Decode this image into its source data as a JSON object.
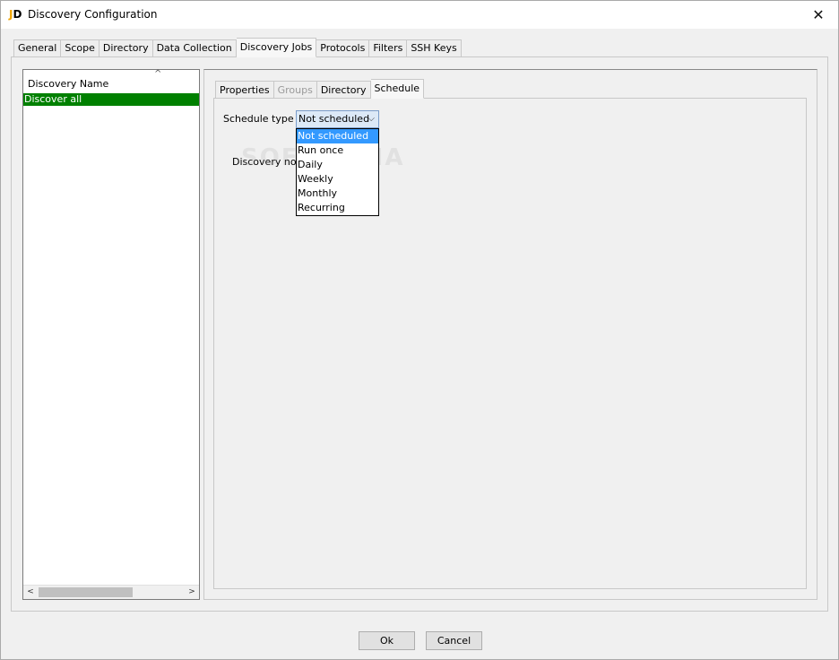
{
  "window": {
    "title": "Discovery Configuration",
    "icon": "jd-logo-icon",
    "close_glyph": "✕"
  },
  "main_tabs": [
    {
      "label": "General"
    },
    {
      "label": "Scope"
    },
    {
      "label": "Directory"
    },
    {
      "label": "Data Collection"
    },
    {
      "label": "Discovery Jobs",
      "active": true
    },
    {
      "label": "Protocols"
    },
    {
      "label": "Filters"
    },
    {
      "label": "SSH Keys"
    }
  ],
  "discovery_list": {
    "header": "Discovery Name",
    "sort_glyph": "^",
    "rows": [
      "Discover all"
    ],
    "selected_color": "#008000",
    "scroll_left": "<",
    "scroll_right": ">"
  },
  "sub_tabs": [
    {
      "label": "Properties"
    },
    {
      "label": "Groups",
      "disabled": true
    },
    {
      "label": "Directory"
    },
    {
      "label": "Schedule",
      "active": true
    }
  ],
  "schedule": {
    "type_label": "Schedule type",
    "selected": "Not scheduled",
    "chevron": "⌵",
    "options": [
      "Not scheduled",
      "Run once",
      "Daily",
      "Weekly",
      "Monthly",
      "Recurring"
    ],
    "status_text": "Discovery not s",
    "highlight_color": "#3399ff"
  },
  "watermark": "SOFTPEDIA",
  "buttons": {
    "ok": "Ok",
    "cancel": "Cancel"
  }
}
